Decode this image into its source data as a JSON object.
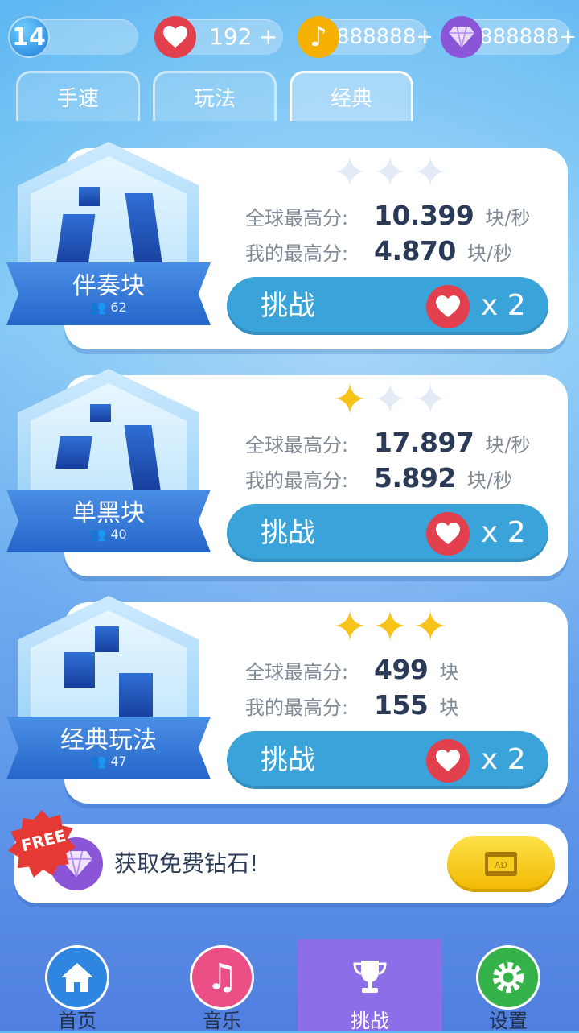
{
  "topbar": {
    "level": "14",
    "lives": "192",
    "lives_add": "+",
    "music_notes": "888888+",
    "gems": "888888+",
    "icons": [
      "level-badge",
      "heart-icon",
      "music-note-icon",
      "diamond-icon"
    ]
  },
  "tabs": [
    {
      "label": "手速",
      "active": false
    },
    {
      "label": "玩法",
      "active": false
    },
    {
      "label": "经典",
      "active": true
    }
  ],
  "modes": [
    {
      "name": "伴奏块",
      "players": "62",
      "stars_earned": 0,
      "stars_total": 3,
      "global_label": "全球最高分:",
      "global_score": "10.399",
      "global_unit": "块/秒",
      "my_label": "我的最高分:",
      "my_score": "4.870",
      "my_unit": "块/秒",
      "button": "挑战",
      "cost": "x 2"
    },
    {
      "name": "单黑块",
      "players": "40",
      "stars_earned": 1,
      "stars_total": 3,
      "global_label": "全球最高分:",
      "global_score": "17.897",
      "global_unit": "块/秒",
      "my_label": "我的最高分:",
      "my_score": "5.892",
      "my_unit": "块/秒",
      "button": "挑战",
      "cost": "x 2"
    },
    {
      "name": "经典玩法",
      "players": "47",
      "stars_earned": 3,
      "stars_total": 3,
      "global_label": "全球最高分:",
      "global_score": "499",
      "global_unit": "块",
      "my_label": "我的最高分:",
      "my_score": "155",
      "my_unit": "块",
      "button": "挑战",
      "cost": "x 2"
    }
  ],
  "free_gems": {
    "badge": "FREE",
    "text": "获取免费钻石!",
    "ad_label": "AD"
  },
  "nav": [
    {
      "label": "首页",
      "icon": "home-icon",
      "color": "#2f86e0",
      "active": false
    },
    {
      "label": "音乐",
      "icon": "music-icon",
      "color": "#ec4f86",
      "active": false
    },
    {
      "label": "挑战",
      "icon": "trophy-icon",
      "color": "#8c6ee8",
      "active": true
    },
    {
      "label": "设置",
      "icon": "gear-icon",
      "color": "#35b24a",
      "active": false
    }
  ],
  "colors": {
    "accent_blue": "#3aa3da",
    "heart_red": "#e2404c",
    "star_gold": "#f7c21a",
    "gem_purple": "#8b55d8",
    "music_gold": "#f6b100"
  }
}
